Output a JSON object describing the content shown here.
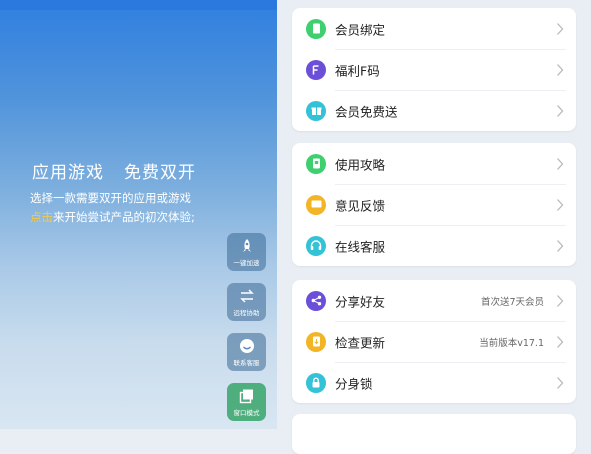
{
  "promo": {
    "title_left": "应用游戏",
    "title_right": "免费双开",
    "line1": "选择一款需要双开的应用或游戏",
    "line2_highlight": "点击",
    "line2_rest": "来开始尝试产品的初次体验;"
  },
  "float_buttons": [
    {
      "label": "一键加速",
      "icon": "rocket-icon"
    },
    {
      "label": "远程协助",
      "icon": "swap-arrows-icon"
    },
    {
      "label": "联系客服",
      "icon": "smiley-icon"
    },
    {
      "label": "窗口模式",
      "icon": "window-icon"
    }
  ],
  "menu": {
    "group1": [
      {
        "label": "会员绑定",
        "icon": "phone-icon",
        "color": "#3ecf6f"
      },
      {
        "label": "福利F码",
        "icon": "f-badge-icon",
        "color": "#6b4fd8"
      },
      {
        "label": "会员免费送",
        "icon": "gift-icon",
        "color": "#33c2d6"
      }
    ],
    "group2": [
      {
        "label": "使用攻略",
        "icon": "guide-icon",
        "color": "#3ecf6f"
      },
      {
        "label": "意见反馈",
        "icon": "feedback-icon",
        "color": "#f2b526"
      },
      {
        "label": "在线客服",
        "icon": "headset-icon",
        "color": "#33c2d6"
      }
    ],
    "group3": [
      {
        "label": "分享好友",
        "icon": "share-icon",
        "color": "#6b4fd8",
        "extra": "首次送7天会员"
      },
      {
        "label": "检查更新",
        "icon": "update-icon",
        "color": "#f2b526",
        "extra": "当前版本v17.1"
      },
      {
        "label": "分身锁",
        "icon": "lock-icon",
        "color": "#33c2d6"
      }
    ]
  }
}
